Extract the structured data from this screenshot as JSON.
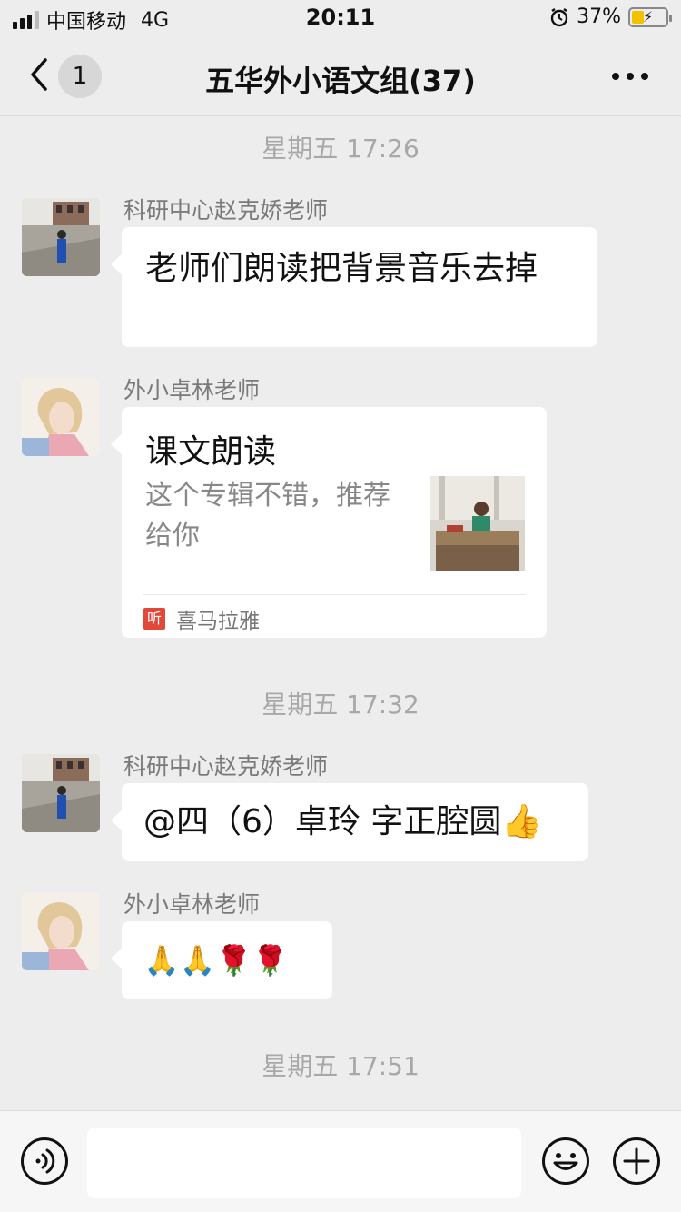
{
  "status_bar": {
    "carrier": "中国移动",
    "network": "4G",
    "time": "20:11",
    "battery": "37%",
    "battery_level": 0.37,
    "alarm_icon": "alarm-icon"
  },
  "nav": {
    "back_icon": "chevron-left-icon",
    "unread_count": "1",
    "title": "五华外小语文组(37)",
    "more_icon": "more-dots-icon"
  },
  "chat": {
    "time_labels": [
      "星期五 17:26",
      "星期五 17:32",
      "星期五 17:51"
    ],
    "messages": [
      {
        "sender": "科研中心赵克娇老师",
        "text": "老师们朗读把背景音乐去掉"
      },
      {
        "sender": "外小卓林老师",
        "card": {
          "title": "课文朗读",
          "description": "这个专辑不错，推荐给你",
          "source_logo": "听",
          "source": "喜马拉雅"
        }
      },
      {
        "sender": "科研中心赵克娇老师",
        "text": "@四（6）卓玲 字正腔圆👍"
      },
      {
        "sender": "外小卓林老师",
        "text": "🙏🙏🌹🌹"
      }
    ]
  },
  "input_bar": {
    "voice_icon": "voice-icon",
    "input_value": "",
    "emoji_icon": "emoji-icon",
    "plus_icon": "plus-icon"
  }
}
